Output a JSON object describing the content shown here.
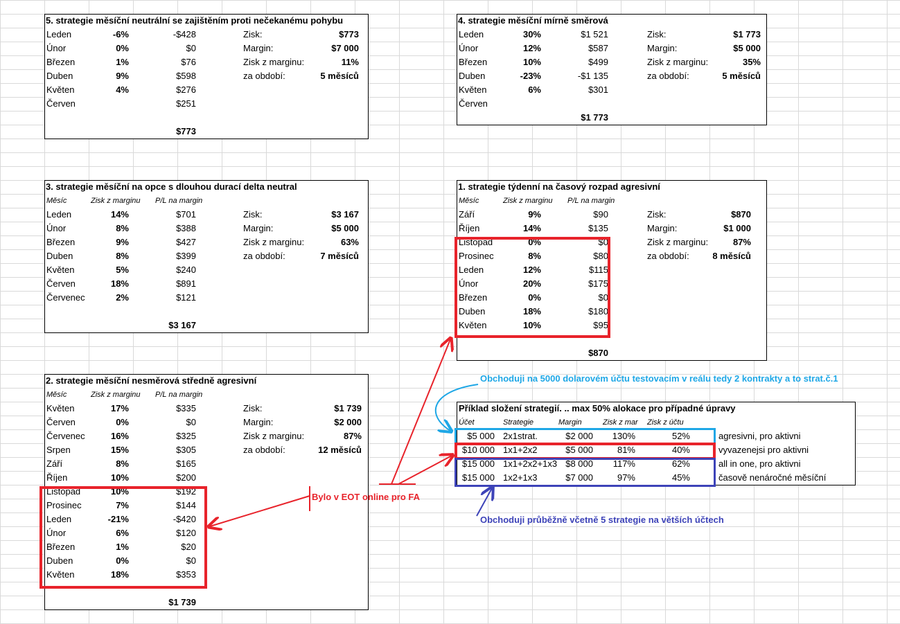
{
  "s5": {
    "title": "5. strategie měsíční neutrální se zajištěním proti nečekanému pohybu",
    "rows": [
      [
        "Leden",
        "-6%",
        "-$428"
      ],
      [
        "Únor",
        "0%",
        "$0"
      ],
      [
        "Březen",
        "1%",
        "$76"
      ],
      [
        "Duben",
        "9%",
        "$598"
      ],
      [
        "Květen",
        "4%",
        "$276"
      ],
      [
        "Červen",
        "",
        "$251"
      ]
    ],
    "summary": [
      [
        "Zisk:",
        "$773"
      ],
      [
        "Margin:",
        "$7 000"
      ],
      [
        "Zisk z marginu:",
        "11%"
      ],
      [
        "za období:",
        "5 měsíců"
      ]
    ],
    "total": "$773"
  },
  "s4": {
    "title": "4. strategie měsíční mírně směrová",
    "rows": [
      [
        "Leden",
        "30%",
        "$1 521"
      ],
      [
        "Únor",
        "12%",
        "$587"
      ],
      [
        "Březen",
        "10%",
        "$499"
      ],
      [
        "Duben",
        "-23%",
        "-$1 135"
      ],
      [
        "Květen",
        "6%",
        "$301"
      ],
      [
        "Červen",
        "",
        ""
      ]
    ],
    "summary": [
      [
        "Zisk:",
        "$1 773"
      ],
      [
        "Margin:",
        "$5 000"
      ],
      [
        "Zisk z marginu:",
        "35%"
      ],
      [
        "za období:",
        "5 měsíců"
      ]
    ],
    "total": "$1 773"
  },
  "s3": {
    "title": "3. strategie měsíční na opce s dlouhou durací delta neutral",
    "headers": [
      "Měsíc",
      "Zisk z marginu",
      "P/L na margin"
    ],
    "rows": [
      [
        "Leden",
        "14%",
        "$701"
      ],
      [
        "Únor",
        "8%",
        "$388"
      ],
      [
        "Březen",
        "9%",
        "$427"
      ],
      [
        "Duben",
        "8%",
        "$399"
      ],
      [
        "Květen",
        "5%",
        "$240"
      ],
      [
        "Červen",
        "18%",
        "$891"
      ],
      [
        "Červenec",
        "2%",
        "$121"
      ]
    ],
    "summary": [
      [
        "Zisk:",
        "$3 167"
      ],
      [
        "Margin:",
        "$5 000"
      ],
      [
        "Zisk z marginu:",
        "63%"
      ],
      [
        "za období:",
        "7 měsíců"
      ]
    ],
    "total": "$3 167"
  },
  "s1": {
    "title": "1. strategie týdenní na časový rozpad agresivní",
    "headers": [
      "Měsíc",
      "Zisk z marginu",
      "P/L na margin"
    ],
    "rows": [
      [
        "Září",
        "9%",
        "$90"
      ],
      [
        "Říjen",
        "14%",
        "$135"
      ],
      [
        "Listopad",
        "0%",
        "$0"
      ],
      [
        "Prosinec",
        "8%",
        "$80"
      ],
      [
        "Leden",
        "12%",
        "$115"
      ],
      [
        "Únor",
        "20%",
        "$175"
      ],
      [
        "Březen",
        "0%",
        "$0"
      ],
      [
        "Duben",
        "18%",
        "$180"
      ],
      [
        "Květen",
        "10%",
        "$95"
      ]
    ],
    "summary": [
      [
        "Zisk:",
        "$870"
      ],
      [
        "Margin:",
        "$1 000"
      ],
      [
        "Zisk z marginu:",
        "87%"
      ],
      [
        "za období:",
        "8 měsíců"
      ]
    ],
    "total": "$870"
  },
  "s2": {
    "title": "2. strategie měsíční nesměrová středně agresivní",
    "headers": [
      "Měsíc",
      "Zisk z marginu",
      "P/L na margin"
    ],
    "rows": [
      [
        "Květen",
        "17%",
        "$335"
      ],
      [
        "Červen",
        "0%",
        "$0"
      ],
      [
        "Červenec",
        "16%",
        "$325"
      ],
      [
        "Srpen",
        "15%",
        "$305"
      ],
      [
        "Září",
        "8%",
        "$165"
      ],
      [
        "Říjen",
        "10%",
        "$200"
      ],
      [
        "Listopad",
        "10%",
        "$192"
      ],
      [
        "Prosinec",
        "7%",
        "$144"
      ],
      [
        "Leden",
        "-21%",
        "-$420"
      ],
      [
        "Únor",
        "6%",
        "$120"
      ],
      [
        "Březen",
        "1%",
        "$20"
      ],
      [
        "Duben",
        "0%",
        "$0"
      ],
      [
        "Květen",
        "18%",
        "$353"
      ]
    ],
    "summary": [
      [
        "Zisk:",
        "$1 739"
      ],
      [
        "Margin:",
        "$2 000"
      ],
      [
        "Zisk z marginu:",
        "87%"
      ],
      [
        "za období:",
        "12 měsíců"
      ]
    ],
    "total": "$1 739"
  },
  "composition": {
    "title": "Příklad složení strategií. .. max 50% alokace pro případné úpravy",
    "headers": [
      "Účet",
      "Strategie",
      "Margin",
      "Zisk z mar",
      "Zisk z účtu"
    ],
    "rows": [
      [
        "$5 000",
        "2x1strat.",
        "$2 000",
        "130%",
        "52%",
        "agresivni, pro aktivni"
      ],
      [
        "$10 000",
        "1x1+2x2",
        "$5 000",
        "81%",
        "40%",
        "vyvazenejsi pro aktivni"
      ],
      [
        "$15 000",
        "1x1+2x2+1x3",
        "$8 000",
        "117%",
        "62%",
        "all in one, pro aktivni"
      ],
      [
        "$15 000",
        "1x2+1x3",
        "$7 000",
        "97%",
        "45%",
        "časově nenáročné měsíční"
      ]
    ]
  },
  "notes": {
    "top_blue": "Obchoduji na 5000 dolarovém účtu testovacím v reálu tedy 2 kontrakty  a to strat.č.1",
    "bottom_blue": "Obchoduji průběžně včetně 5 strategie na větších účtech",
    "red": "Bylo v EOT online pro FA"
  },
  "colors": {
    "red": "#e8232b",
    "light_blue": "#1ea7e6",
    "dark_blue": "#3d43b8",
    "grid": "#d9d9d9"
  }
}
